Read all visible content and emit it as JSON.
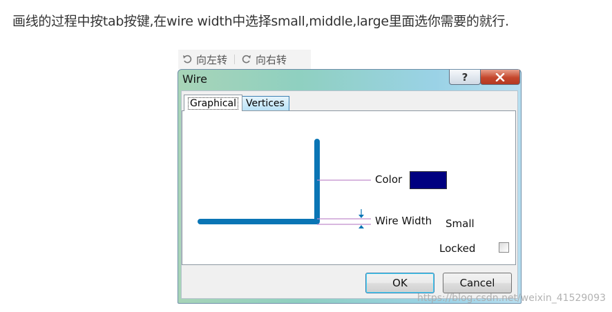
{
  "caption": "画线的过程中按tab按键,在wire width中选择small,middle,large里面选你需要的就行.",
  "rotate_toolbar": {
    "rotate_left": "向左转",
    "rotate_right": "向右转"
  },
  "dialog": {
    "title": "Wire",
    "help_label": "?",
    "tabs": [
      "Graphical",
      "Vertices"
    ],
    "color_label": "Color",
    "color_value": "#000080",
    "wire_width_label": "Wire Width",
    "wire_width_value": "Small",
    "locked_label": "Locked",
    "locked_checked": false,
    "ok_label": "OK",
    "cancel_label": "Cancel"
  },
  "watermark": "https://blog.csdn.net/weixin_41529093"
}
